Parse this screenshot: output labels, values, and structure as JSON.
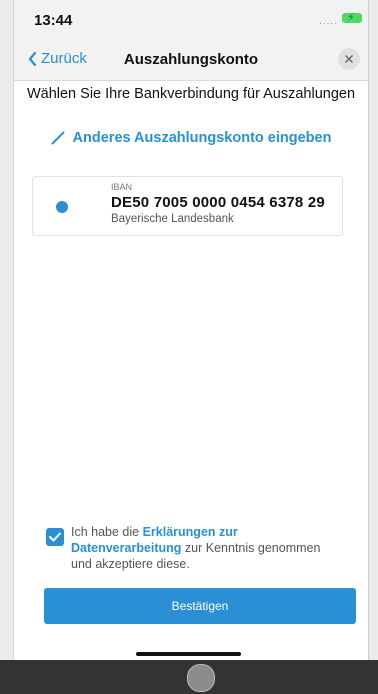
{
  "status_bar": {
    "time": "13:44",
    "signal": "....."
  },
  "nav": {
    "back_label": "Zurück",
    "title": "Auszahlungskonto"
  },
  "main": {
    "heading": "Wählen Sie Ihre Bankverbindung für Auszahlungen",
    "alt_account_link": "Anderes Auszahlungskonto eingeben",
    "account": {
      "iban_label": "IBAN",
      "iban": "DE50 7005 0000 0454 6378 29",
      "bank": "Bayerische Landesbank",
      "selected": true
    }
  },
  "consent": {
    "checked": true,
    "text_before": "Ich habe die ",
    "link_text": "Erklärungen zur Datenverarbeitung",
    "text_after": " zur Kenntnis genommen und akzeptiere diese."
  },
  "confirm_button": "Bestätigen",
  "colors": {
    "accent": "#2a8fd4",
    "battery": "#4cd964",
    "header_bg": "#f2f2f2"
  },
  "icons": {
    "back": "chevron-left-icon",
    "close": "close-icon",
    "edit": "pencil-icon",
    "check": "checkmark-icon"
  }
}
